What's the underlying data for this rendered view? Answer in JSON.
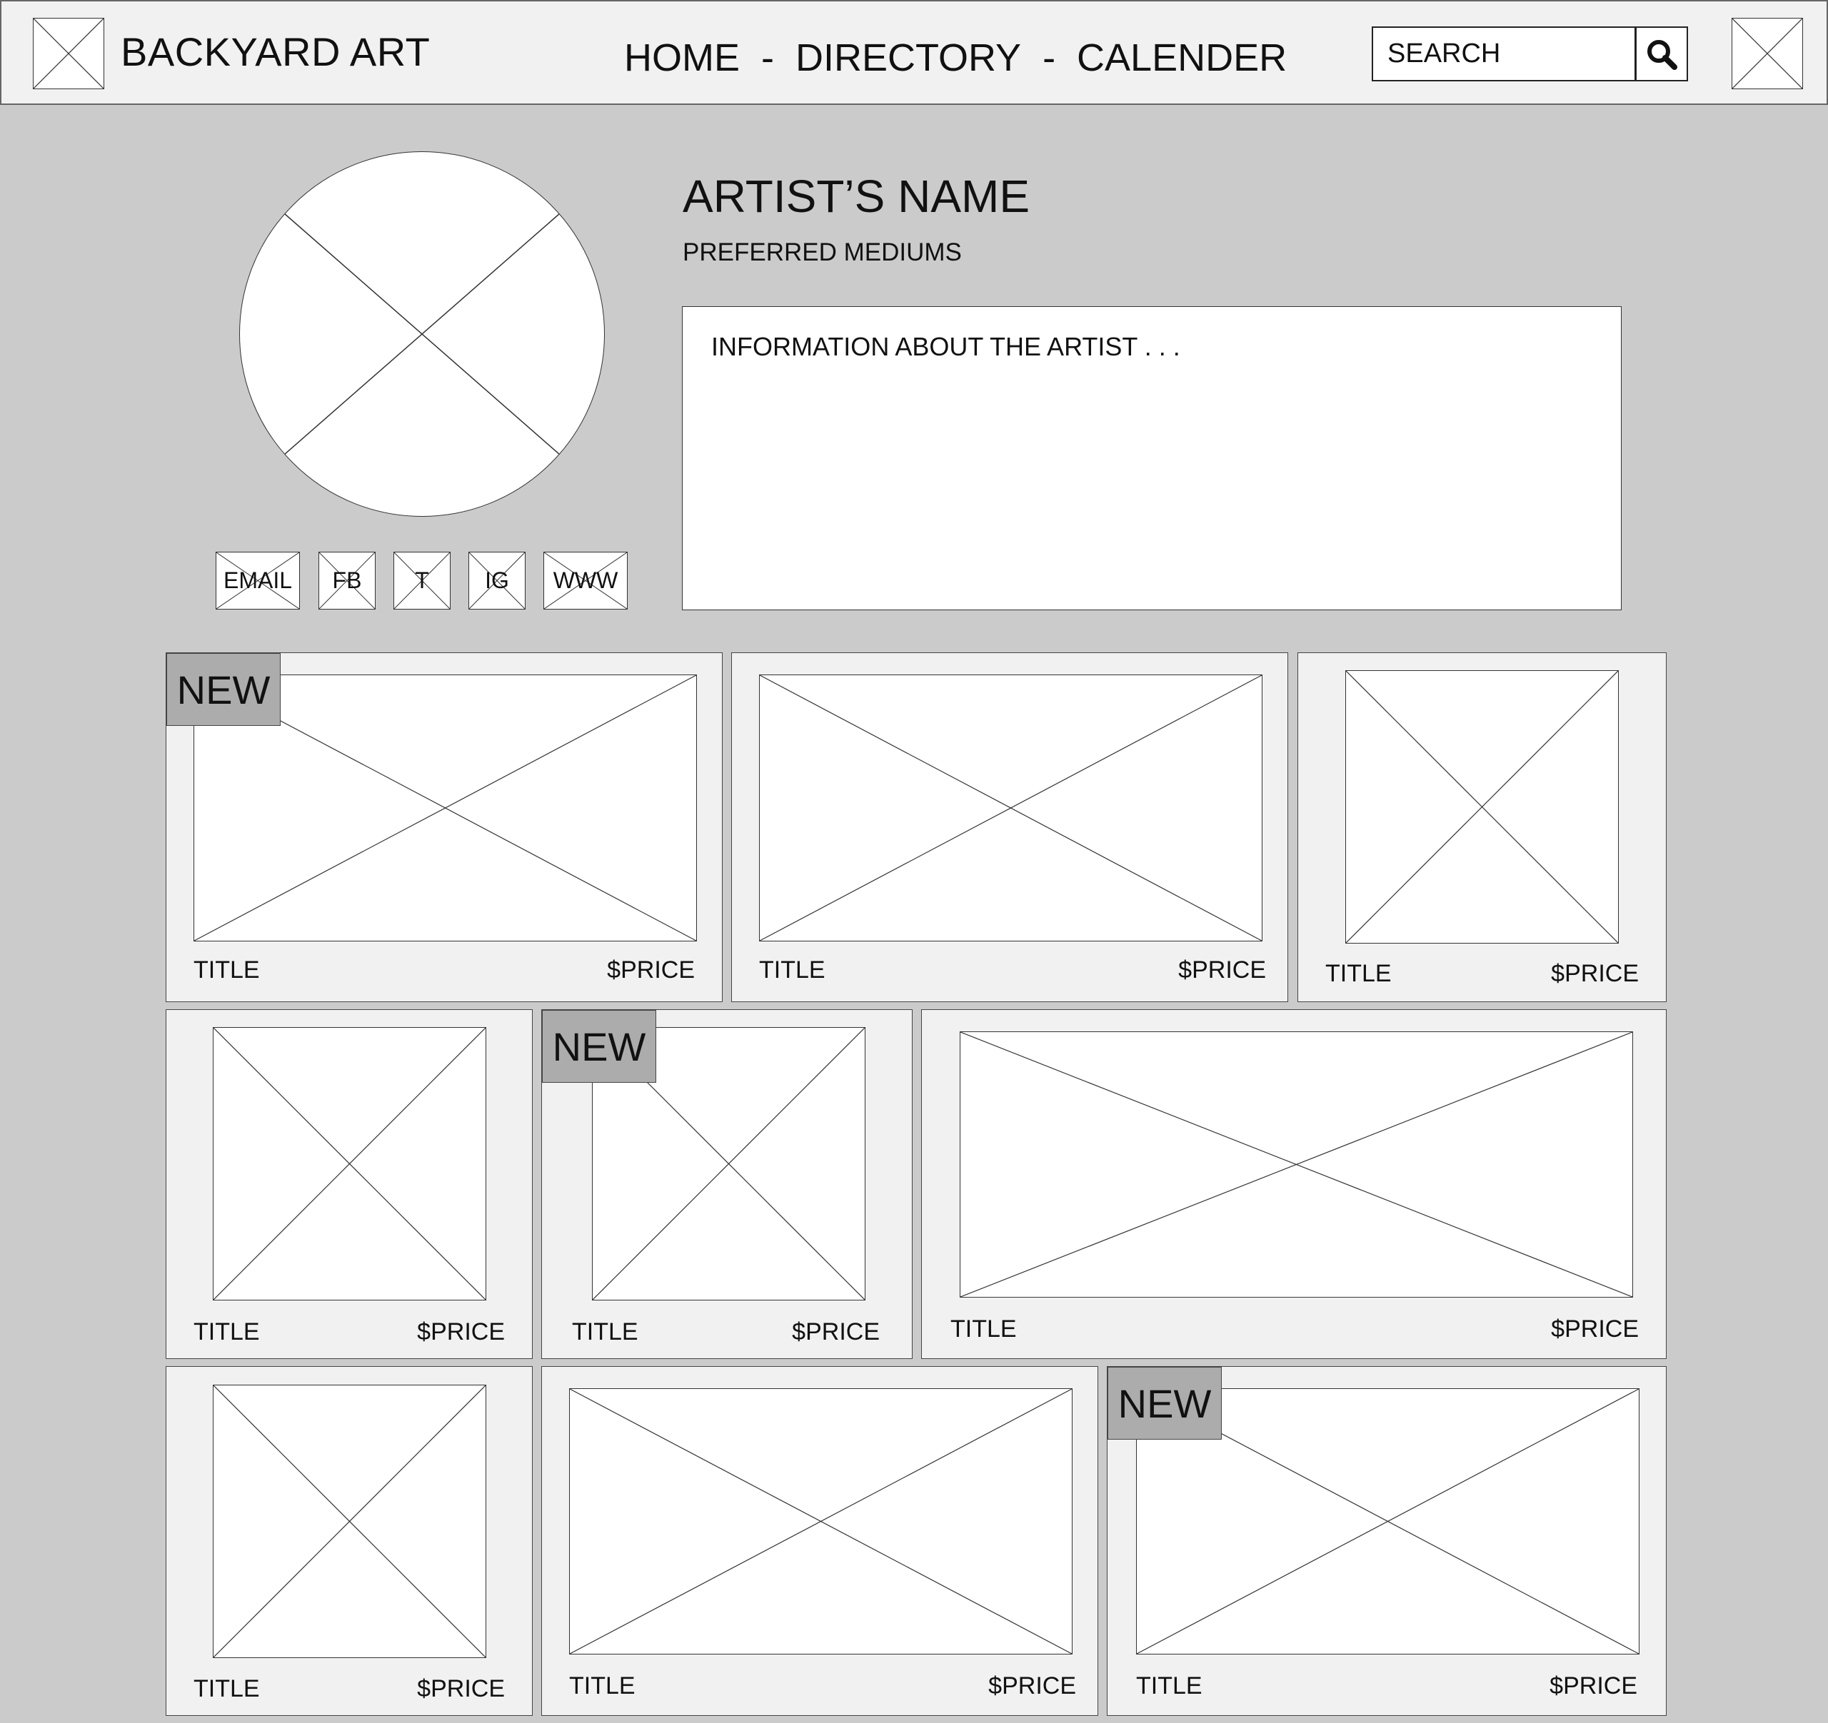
{
  "header": {
    "site_title": "BACKYARD ART",
    "nav": [
      "HOME",
      "DIRECTORY",
      "CALENDER"
    ],
    "nav_separator": "-",
    "search_placeholder": "SEARCH",
    "logo_icon": "image-placeholder-icon",
    "menu_icon": "image-placeholder-icon",
    "search_icon": "magnifier-icon"
  },
  "profile": {
    "name": "ARTIST’S NAME",
    "mediums": "PREFERRED MEDIUMS",
    "info": "INFORMATION ABOUT THE ARTIST . . .",
    "social": [
      "EMAIL",
      "FB",
      "T",
      "IG",
      "WWW"
    ]
  },
  "gallery": [
    {
      "title": "TITLE",
      "price": "$PRICE",
      "badge": "NEW"
    },
    {
      "title": "TITLE",
      "price": "$PRICE"
    },
    {
      "title": "TITLE",
      "price": "$PRICE"
    },
    {
      "title": "TITLE",
      "price": "$PRICE"
    },
    {
      "title": "TITLE",
      "price": "$PRICE",
      "badge": "NEW"
    },
    {
      "title": "TITLE",
      "price": "$PRICE"
    },
    {
      "title": "TITLE",
      "price": "$PRICE"
    },
    {
      "title": "TITLE",
      "price": "$PRICE"
    },
    {
      "title": "TITLE",
      "price": "$PRICE",
      "badge": "NEW"
    }
  ],
  "colors": {
    "page_background": "#cbcbcb",
    "panel_background": "#f1f1f1",
    "badge_background": "#acacac",
    "placeholder_fill": "#ffffff",
    "line": "#333333"
  }
}
